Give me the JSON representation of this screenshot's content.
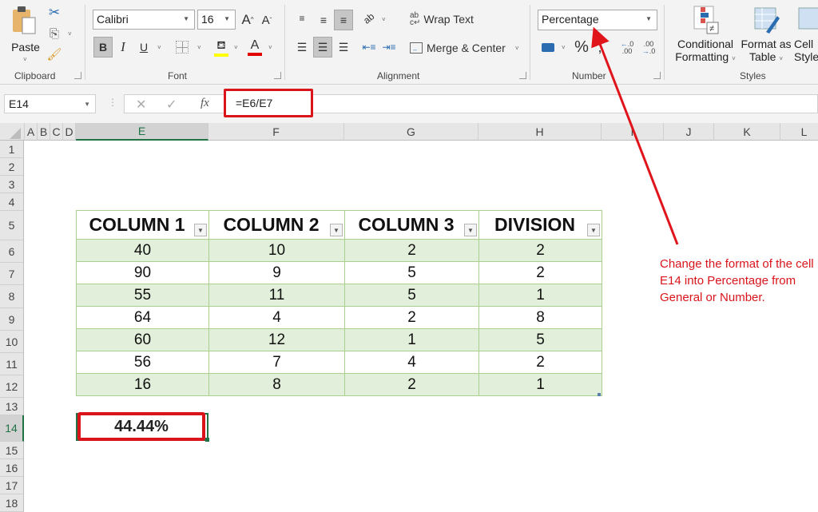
{
  "ribbon": {
    "clipboard": {
      "label": "Clipboard",
      "paste": "Paste"
    },
    "font": {
      "label": "Font",
      "family": "Calibri",
      "size": "16",
      "bold": "B",
      "italic": "I",
      "underline": "U",
      "grow": "A",
      "shrink": "A",
      "fill_color": "#ffff00",
      "font_color": "#e00000"
    },
    "alignment": {
      "label": "Alignment",
      "wrap_text": "Wrap Text",
      "merge_center": "Merge & Center"
    },
    "number": {
      "label": "Number",
      "format": "Percentage",
      "percent": "%",
      "comma": ",",
      "inc_decimal": "←.0 .00",
      "dec_decimal": ".00 →.0"
    },
    "styles": {
      "label": "Styles",
      "conditional_formatting": [
        "Conditional",
        "Formatting"
      ],
      "format_as_table": [
        "Format as",
        "Table"
      ],
      "cell_styles": [
        "Cell",
        "Styles"
      ]
    }
  },
  "formula_bar": {
    "name_box": "E14",
    "cancel": "✕",
    "enter": "✓",
    "fx": "fx",
    "formula": "=E6/E7"
  },
  "columns": [
    "A",
    "B",
    "C",
    "D",
    "E",
    "F",
    "G",
    "H",
    "I",
    "J",
    "K",
    "L"
  ],
  "rows": [
    "1",
    "2",
    "3",
    "4",
    "5",
    "6",
    "7",
    "8",
    "9",
    "10",
    "11",
    "12",
    "13",
    "14",
    "15",
    "16",
    "17",
    "18"
  ],
  "selected_cell": "E14",
  "table": {
    "headers": [
      "COLUMN 1",
      "COLUMN 2",
      "COLUMN 3",
      "DIVISION"
    ],
    "rows": [
      [
        "40",
        "10",
        "2",
        "2"
      ],
      [
        "90",
        "9",
        "5",
        "2"
      ],
      [
        "55",
        "11",
        "5",
        "1"
      ],
      [
        "64",
        "4",
        "2",
        "8"
      ],
      [
        "60",
        "12",
        "1",
        "5"
      ],
      [
        "56",
        "7",
        "4",
        "2"
      ],
      [
        "16",
        "8",
        "2",
        "1"
      ]
    ]
  },
  "result_value": "44.44%",
  "annotation": "Change the format of the cell E14 into Percentage from General or Number.",
  "colors": {
    "accent_red": "#d9141b",
    "excel_green": "#217346",
    "table_band": "#e2efda",
    "table_border": "#a9d08e"
  }
}
